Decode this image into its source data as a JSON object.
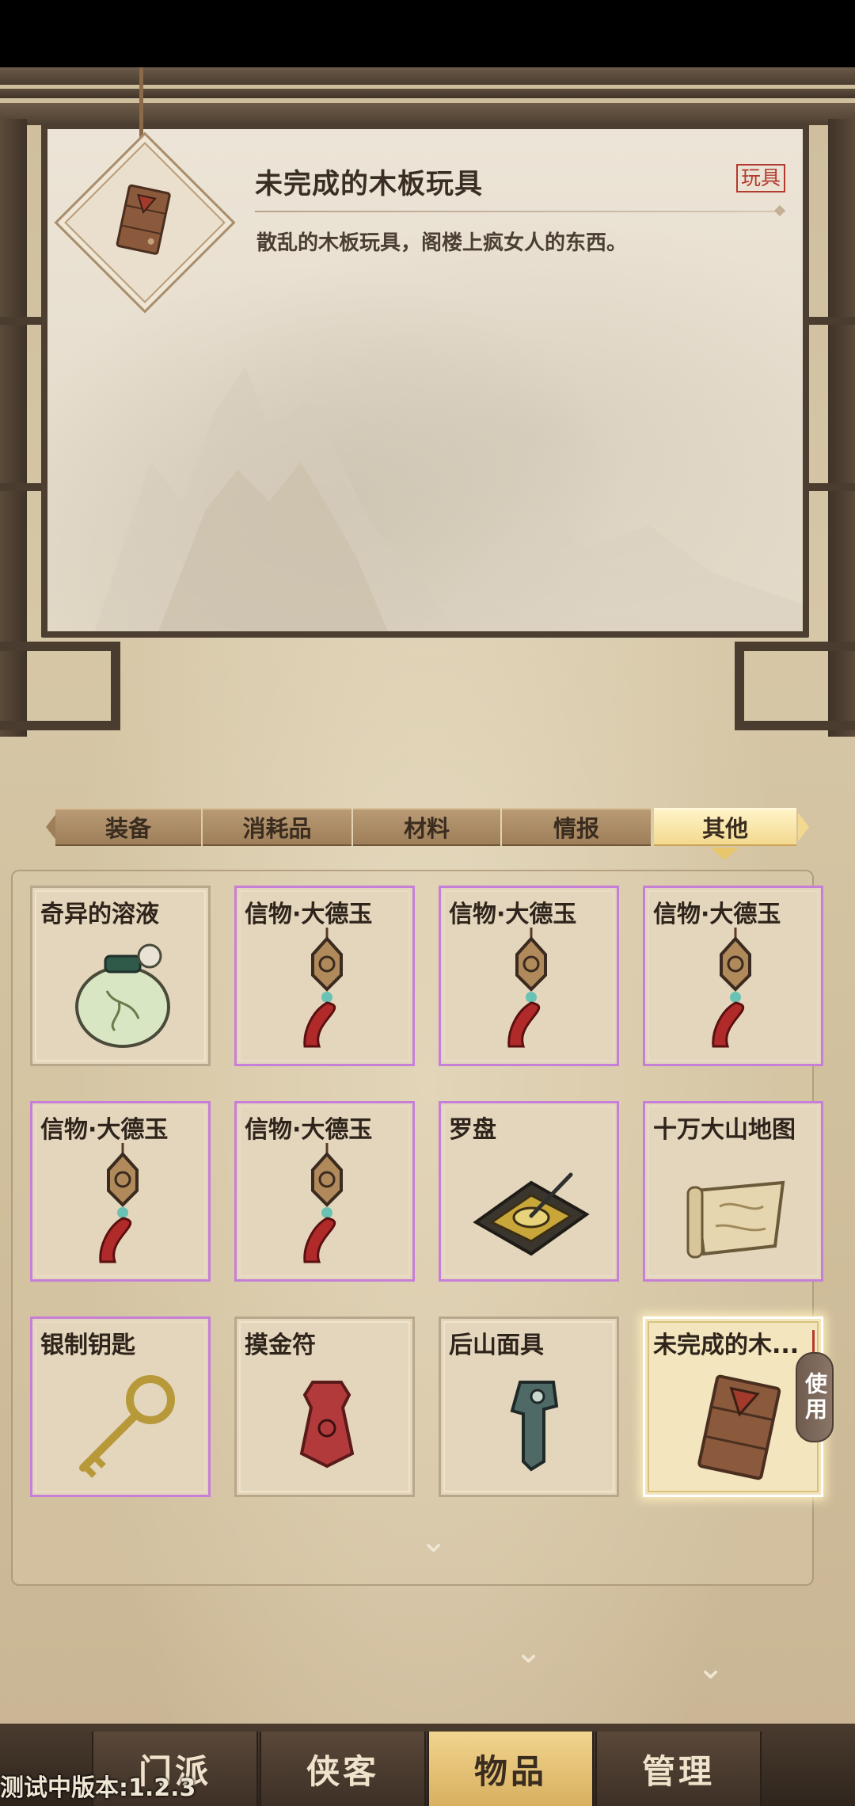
{
  "detail": {
    "title": "未完成的木板玩具",
    "tag": "玩具",
    "description": "散乱的木板玩具，阁楼上疯女人的东西。"
  },
  "tabs": [
    {
      "label": "装备",
      "active": false
    },
    {
      "label": "消耗品",
      "active": false
    },
    {
      "label": "材料",
      "active": false
    },
    {
      "label": "情报",
      "active": false
    },
    {
      "label": "其他",
      "active": true
    }
  ],
  "items": [
    {
      "name": "奇异的溶液",
      "icon": "potion-jar-icon",
      "rarity": "common"
    },
    {
      "name": "信物·大德玉",
      "icon": "jade-pendant-icon",
      "rarity": "purple"
    },
    {
      "name": "信物·大德玉",
      "icon": "jade-pendant-icon",
      "rarity": "purple"
    },
    {
      "name": "信物·大德玉",
      "icon": "jade-pendant-icon",
      "rarity": "purple"
    },
    {
      "name": "信物·大德玉",
      "icon": "jade-pendant-icon",
      "rarity": "purple"
    },
    {
      "name": "信物·大德玉",
      "icon": "jade-pendant-icon",
      "rarity": "purple"
    },
    {
      "name": "罗盘",
      "icon": "compass-icon",
      "rarity": "purple"
    },
    {
      "name": "十万大山地图",
      "icon": "map-scroll-icon",
      "rarity": "purple"
    },
    {
      "name": "银制钥匙",
      "icon": "key-icon",
      "rarity": "purple"
    },
    {
      "name": "摸金符",
      "icon": "talisman-icon",
      "rarity": "common"
    },
    {
      "name": "后山面具",
      "icon": "mask-icon",
      "rarity": "common"
    },
    {
      "name": "未完成的木...",
      "icon": "wooden-board-icon",
      "rarity": "selected"
    }
  ],
  "use_button": "使用",
  "nav": [
    {
      "label": "门派",
      "active": false
    },
    {
      "label": "侠客",
      "active": false
    },
    {
      "label": "物品",
      "active": true
    },
    {
      "label": "管理",
      "active": false
    }
  ],
  "version": "测试中版本:1.2.3",
  "colors": {
    "rarity_purple": "#c67fd6",
    "tab_active": "#f3d98f",
    "tag_red": "#b33a2e",
    "nav_active": "#d8b060"
  }
}
